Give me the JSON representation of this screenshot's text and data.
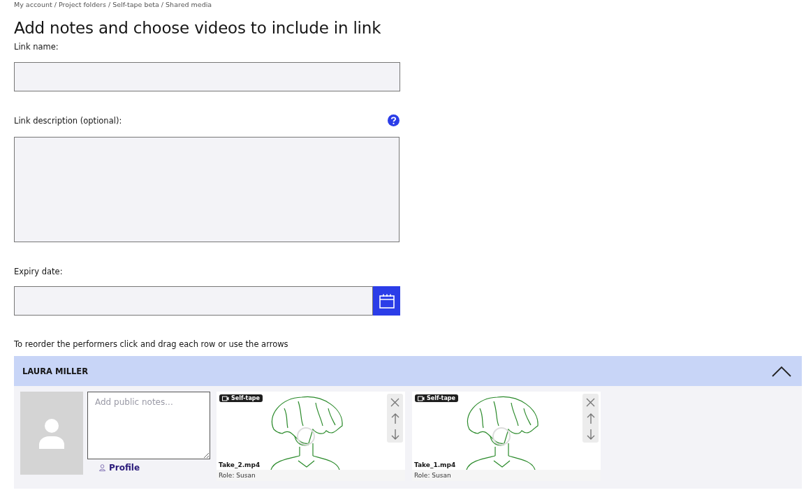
{
  "breadcrumb": "My account / Project folders / Self-tape beta / Shared media",
  "title": "Add notes and choose videos to include in link",
  "link_name": {
    "label": "Link name:"
  },
  "link_description": {
    "label": "Link description (optional):"
  },
  "expiry_date": {
    "label": "Expiry date:"
  },
  "instruction": "To reorder the performers click and drag each row or use the arrows",
  "performers": [
    {
      "name": "LAURA MILLER",
      "expanded": true,
      "notes_placeholder": "Add public notes...",
      "profile_link": "Profile",
      "videos": [
        {
          "badge": "Self-tape",
          "filename": "Take_2.mp4",
          "role": "Role: Susan"
        },
        {
          "badge": "Self-tape",
          "filename": "Take_1.mp4",
          "role": "Role: Susan"
        }
      ]
    }
  ]
}
